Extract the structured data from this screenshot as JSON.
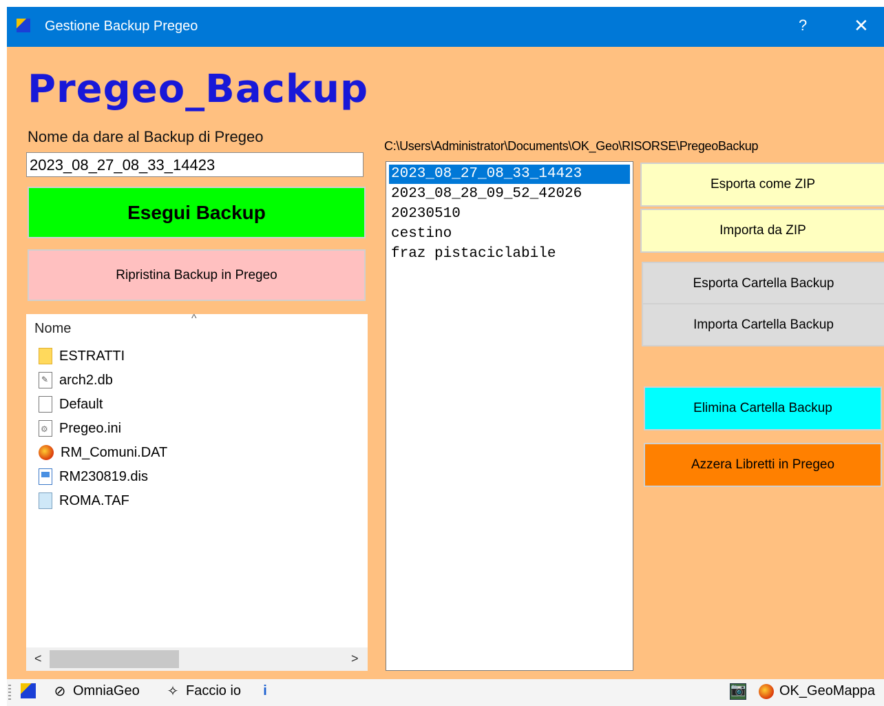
{
  "window": {
    "title": "Gestione Backup Pregeo",
    "help_label": "?",
    "close_label": "✕"
  },
  "header": {
    "title": "Pregeo_Backup"
  },
  "backup_name": {
    "label": "Nome da dare al Backup di Pregeo",
    "value": "2023_08_27_08_33_14423"
  },
  "buttons": {
    "esegui": "Esegui Backup",
    "ripristina": "Ripristina Backup in Pregeo",
    "esporta_zip": "Esporta come ZIP",
    "importa_zip": "Importa da ZIP",
    "esporta_cartella": "Esporta Cartella Backup",
    "importa_cartella": "Importa Cartella Backup",
    "elimina": "Elimina Cartella Backup",
    "azzera": "Azzera Libretti in Pregeo"
  },
  "explorer": {
    "column_header": "Nome",
    "files": [
      {
        "name": "ESTRATTI",
        "icon": "folder-icon"
      },
      {
        "name": "arch2.db",
        "icon": "db-file-icon"
      },
      {
        "name": "Default",
        "icon": "file-icon"
      },
      {
        "name": "Pregeo.ini",
        "icon": "settings-file-icon"
      },
      {
        "name": "RM_Comuni.DAT",
        "icon": "dat-file-icon"
      },
      {
        "name": "RM230819.dis",
        "icon": "image-file-icon"
      },
      {
        "name": "ROMA.TAF",
        "icon": "taf-file-icon"
      }
    ]
  },
  "backup_list": {
    "path": "C:\\Users\\Administrator\\Documents\\OK_Geo\\RISORSE\\PregeoBackup",
    "items": [
      "2023_08_27_08_33_14423",
      "2023_08_28_09_52_42026",
      "20230510",
      "cestino",
      "fraz pistaciclabile"
    ],
    "selected_index": 0
  },
  "statusbar": {
    "omniageo": "OmniaGeo",
    "faccio_io": "Faccio io",
    "ok_geomappa": "OK_GeoMappa"
  },
  "colors": {
    "background": "#ffc080",
    "titlebar": "#0078d7",
    "title_text": "#1818d8",
    "esegui": "#00ff00",
    "ripristina": "#ffc0c0",
    "zip_buttons": "#ffffc0",
    "cartella_buttons": "#dcdcdc",
    "elimina": "#00ffff",
    "azzera": "#ff8000"
  }
}
